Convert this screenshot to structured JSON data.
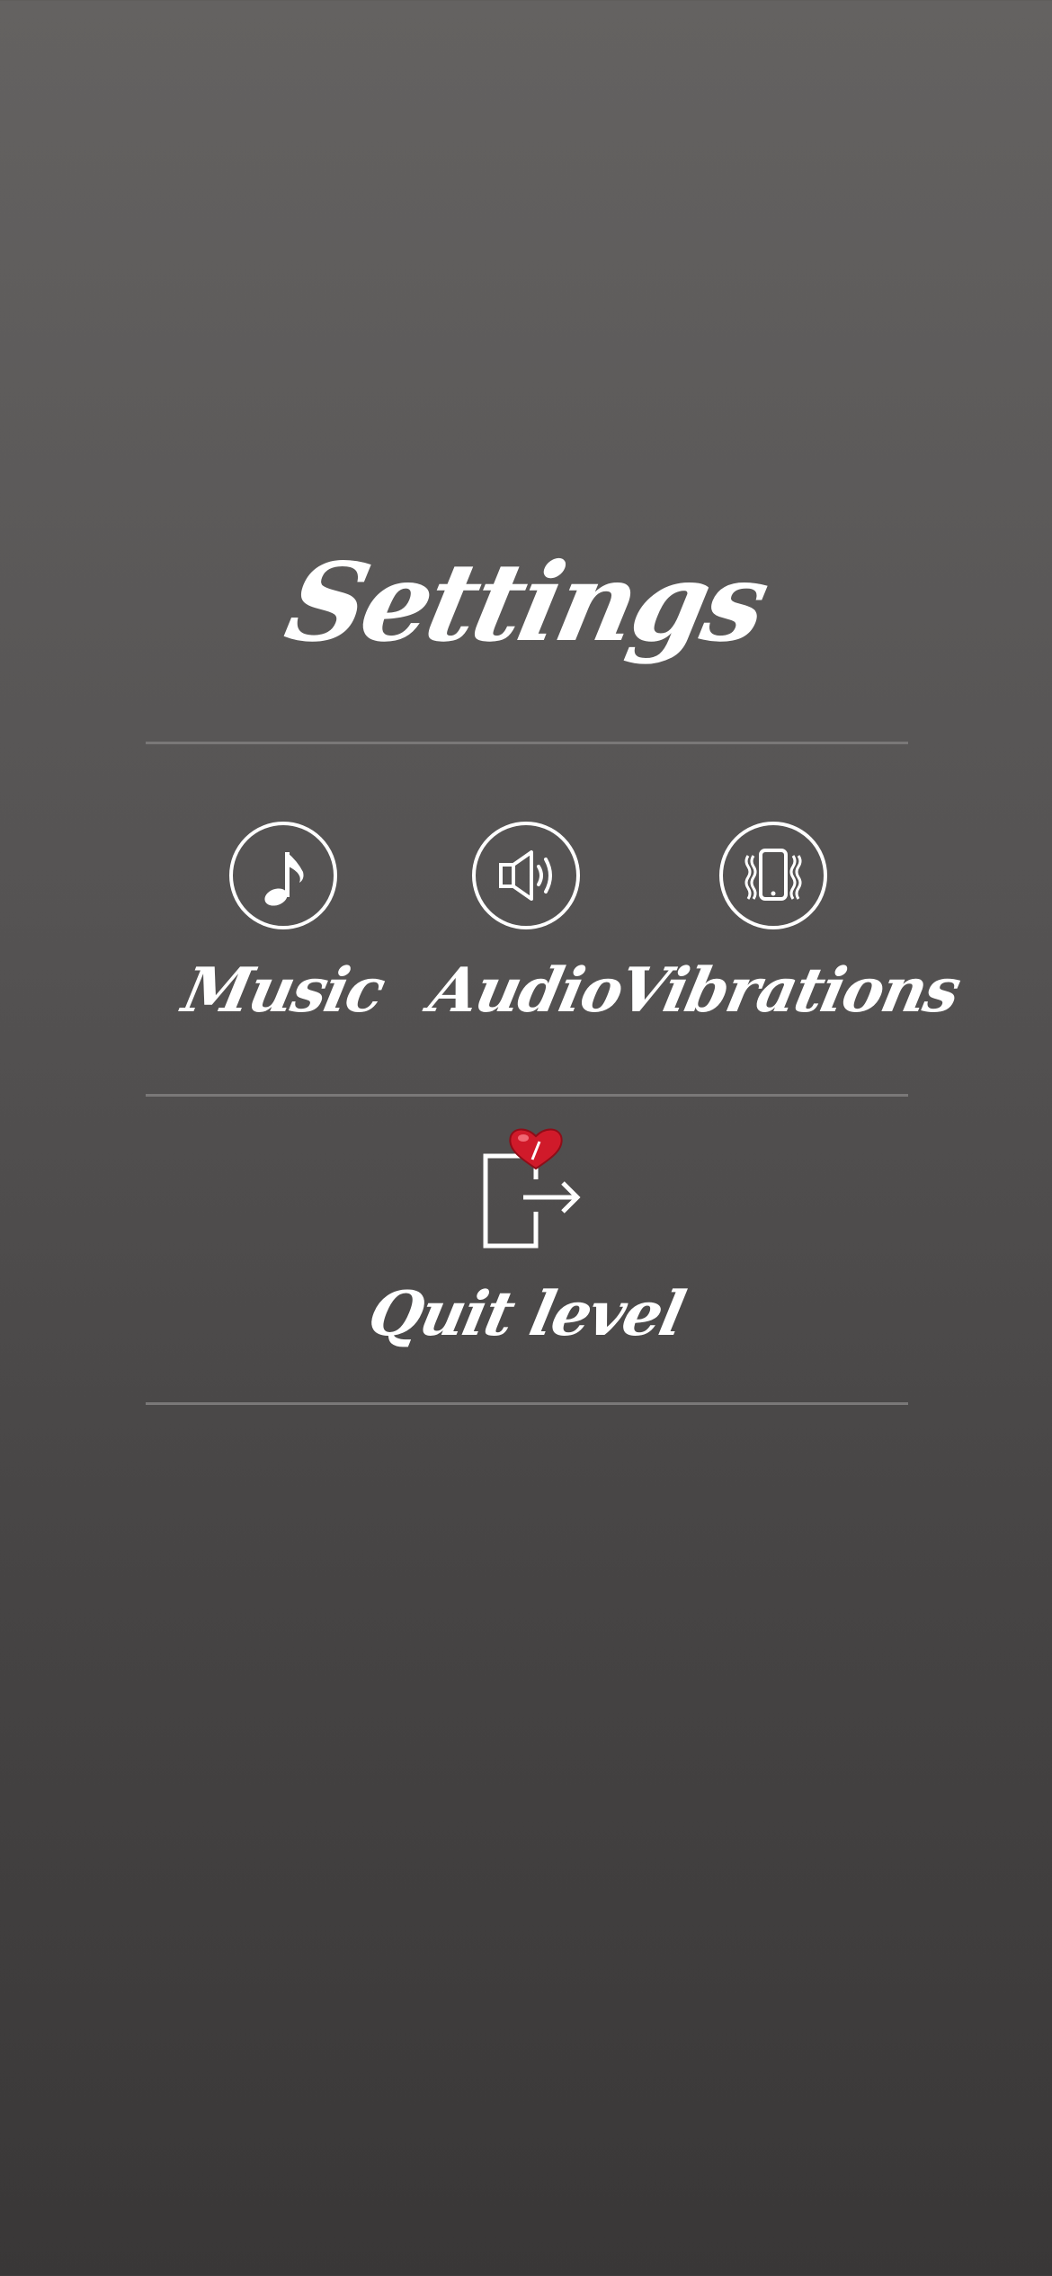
{
  "screen": {
    "title": "Settings"
  },
  "options": [
    {
      "label": "Music",
      "icon": "music-note-icon"
    },
    {
      "label": "Audio",
      "icon": "speaker-icon"
    },
    {
      "label": "Vibrations",
      "icon": "phone-vibrate-icon"
    }
  ],
  "quit": {
    "label": "Quit level",
    "icon": "exit-door-icon",
    "badge_icon": "heart-icon"
  },
  "colors": {
    "text": "#ffffff",
    "divider": "#7a7878",
    "heart": "#d01a2a"
  }
}
